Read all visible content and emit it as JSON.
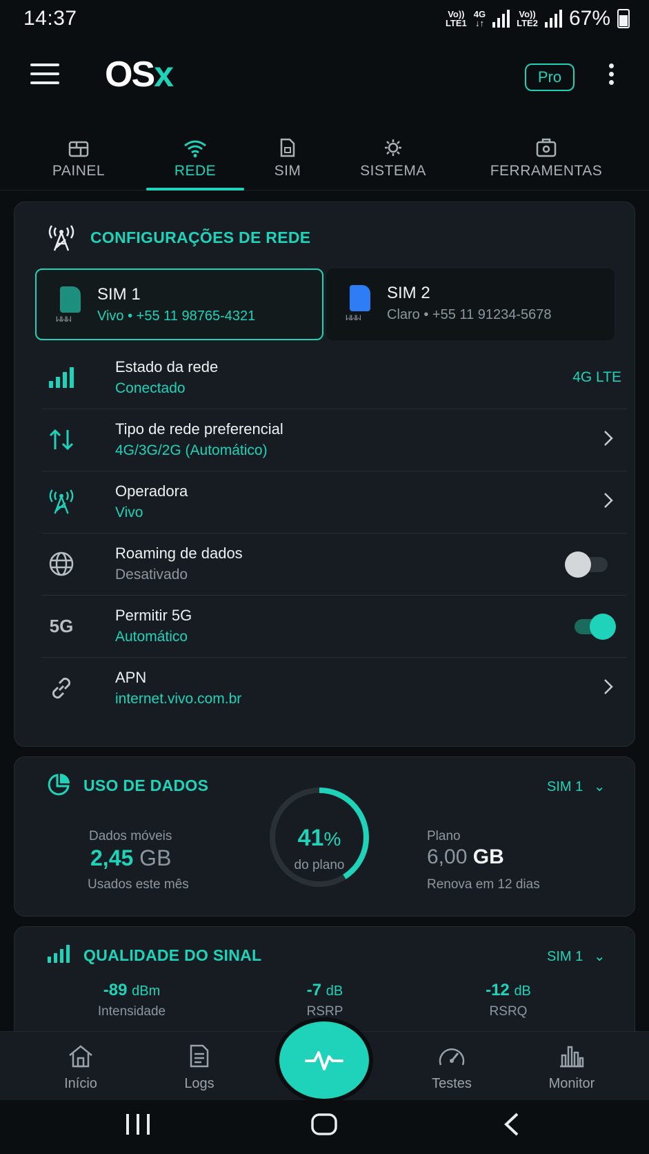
{
  "status_bar": {
    "time": "14:37",
    "sim1_volte": "Vo))",
    "sim1_lte": "LTE1",
    "net_type": "4G",
    "sim2_volte": "Vo))",
    "sim2_lte": "LTE2",
    "battery": "67%"
  },
  "app_bar": {
    "logo_main": "OS",
    "logo_accent": "x",
    "pro_label": "Pro",
    "icons": [
      "menu-icon",
      "more-vert-icon"
    ]
  },
  "tabs": [
    {
      "label": "PAINEL",
      "icon": "dashboard-icon"
    },
    {
      "label": "REDE",
      "icon": "wifi-icon",
      "active": true
    },
    {
      "label": "SIM",
      "icon": "sim-card-icon"
    },
    {
      "label": "SISTEMA",
      "icon": "settings-cog-icon"
    },
    {
      "label": "FERRAMENTAS",
      "icon": "tools-icon"
    }
  ],
  "network_card": {
    "title": "CONFIGURAÇÕES DE REDE",
    "sims": [
      {
        "name": "SIM 1",
        "carrier_line": "Vivo • +55 11 98765-4321",
        "wave": "ᥕᥕᥕ",
        "color": "#1ed3b9",
        "active": true
      },
      {
        "name": "SIM 2",
        "carrier_line": "Claro • +55 11 91234-5678",
        "wave": "ᥕᥕᥕ",
        "color": "#2f7df6",
        "active": false
      }
    ],
    "rows": [
      {
        "title": "Estado da rede",
        "subtitle": "Conectado",
        "value": "4G LTE",
        "icon": "signal-bars-icon"
      },
      {
        "title": "Tipo de rede preferencial",
        "subtitle": "4G/3G/2G (Automático)",
        "icon": "swap-vert-icon"
      },
      {
        "title": "Operadora",
        "subtitle": "Vivo",
        "icon": "cell-tower-icon"
      },
      {
        "title": "Roaming de dados",
        "subtitle": "Desativado",
        "icon": "globe-icon",
        "toggle_on": false
      },
      {
        "title": "Permitir 5G",
        "subtitle": "Automático",
        "icon_text": "5G",
        "toggle_on": true
      },
      {
        "title": "APN",
        "subtitle": "internet.vivo.com.br",
        "icon": "link-icon"
      }
    ]
  },
  "data_usage_card": {
    "title": "USO DE DADOS",
    "selector": "SIM 1",
    "mobile_label": "Dados móveis",
    "used_value": "2,45",
    "used_unit": "GB",
    "used_caption": "Usados este mês",
    "percent_value": "41",
    "percent_sign": "%",
    "percent_caption": "do plano",
    "percent_fraction": 0.41,
    "plan_label": "Plano",
    "plan_value": "6,00",
    "plan_unit": "GB",
    "renew_caption": "Renova em 12 dias"
  },
  "signal_card": {
    "title": "QUALIDADE DO SINAL",
    "selector": "SIM 1",
    "metrics": [
      {
        "value": "-89",
        "unit": "dBm",
        "label": "Intensidade"
      },
      {
        "value": "-7",
        "unit": "dB",
        "label": "RSRP"
      },
      {
        "value": "-12",
        "unit": "dB",
        "label": "RSRQ"
      }
    ]
  },
  "bottom_nav": {
    "items": [
      {
        "label": "Início",
        "icon": "home-icon"
      },
      {
        "label": "Logs",
        "icon": "document-icon"
      },
      {
        "label": "Testes",
        "icon": "speedometer-icon"
      },
      {
        "label": "Monitor",
        "icon": "bar-chart-icon"
      }
    ],
    "fab_icon": "pulse-icon"
  },
  "colors": {
    "accent": "#1ed3b9",
    "background": "#0b0e11",
    "card": "#161c21",
    "sim2": "#2f7df6"
  }
}
